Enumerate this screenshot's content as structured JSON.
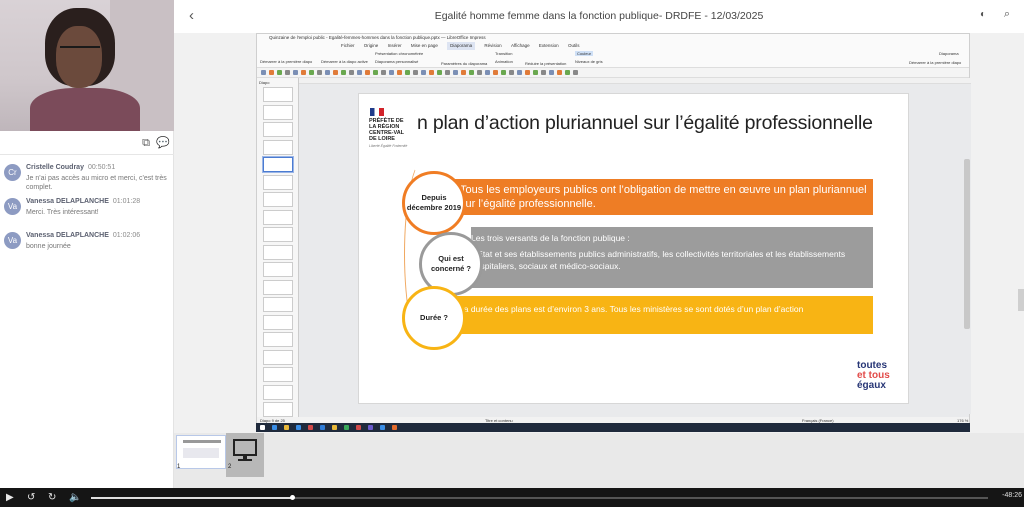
{
  "window": {
    "title": "Egalité homme femme dans la fonction publique- DRDFE - 12/03/2025"
  },
  "chat": [
    {
      "initials": "Cr",
      "name": "Cristelle Coudray",
      "time": "00:50:51",
      "text": "Je n'ai pas accès au micro et merci, c'est très complet."
    },
    {
      "initials": "Va",
      "name": "Vanessa DELAPLANCHE",
      "time": "01:01:28",
      "text": "Merci. Très intéressant!"
    },
    {
      "initials": "Va",
      "name": "Vanessa DELAPLANCHE",
      "time": "01:02:06",
      "text": "bonne journée"
    }
  ],
  "impress": {
    "title_bar": "Quinzaine de l'emploi public - Egalité-femmes-hommes dans la fonction publique.pptx — LibreOffice Impress",
    "menu": [
      "Fichier",
      "Origine",
      "Insérer",
      "Mise en page",
      "Diaporama",
      "Révision",
      "Affichage",
      "Extension",
      "Outils"
    ],
    "ribbon": {
      "b1": "Présentation chronométrée",
      "b2": "Démarrer à la première diapo",
      "b3": "Démarrer à la diapo active",
      "b4": "Diaporama personnalisé",
      "b5": "Transition",
      "b6": "Animation",
      "b7": "Paramètres du diaporama",
      "b8": "Réduire la présentation",
      "b9": "Couleur",
      "b10": "Niveaux de gris",
      "b11": "Diaporama",
      "b12": "Démarrer à la première diapo"
    },
    "panel_header": "Diapo",
    "status": {
      "slide": "Diapo 9 de 25",
      "layout": "Titre et contenu",
      "lang": "Français (France)",
      "zoom": "176 %"
    }
  },
  "slide": {
    "logo_text": "PRÉFÈTE DE LA RÉGION CENTRE-VAL DE LOIRE",
    "logo_motto": "Liberté Égalité Fraternité",
    "title": "n plan d’action pluriannuel sur l’égalité professionnelle",
    "items": [
      {
        "label": "Depuis décembre 2019",
        "text": "Tous les employeurs publics ont l’obligation de mettre en œuvre un plan pluriannuel sur l’égalité professionnelle."
      },
      {
        "label": "Qui est concerné ?",
        "line1": "Les trois versants de la fonction publique :",
        "line2": "L’Etat et ses établissements publics administratifs, les collectivités territoriales et les établissements hospitaliers, sociaux et médico-sociaux."
      },
      {
        "label": "Durée ?",
        "text": "La durée des plans est d’environ 3 ans. Tous les ministères se sont dotés d’un plan d’action"
      }
    ],
    "brand": {
      "l1": "toutes",
      "l2": "et tous",
      "l3": "égaux"
    }
  },
  "filmstrip": {
    "n1": "1",
    "n2": "2"
  },
  "player": {
    "time_remaining": "-48:26",
    "progress": 0.224
  }
}
